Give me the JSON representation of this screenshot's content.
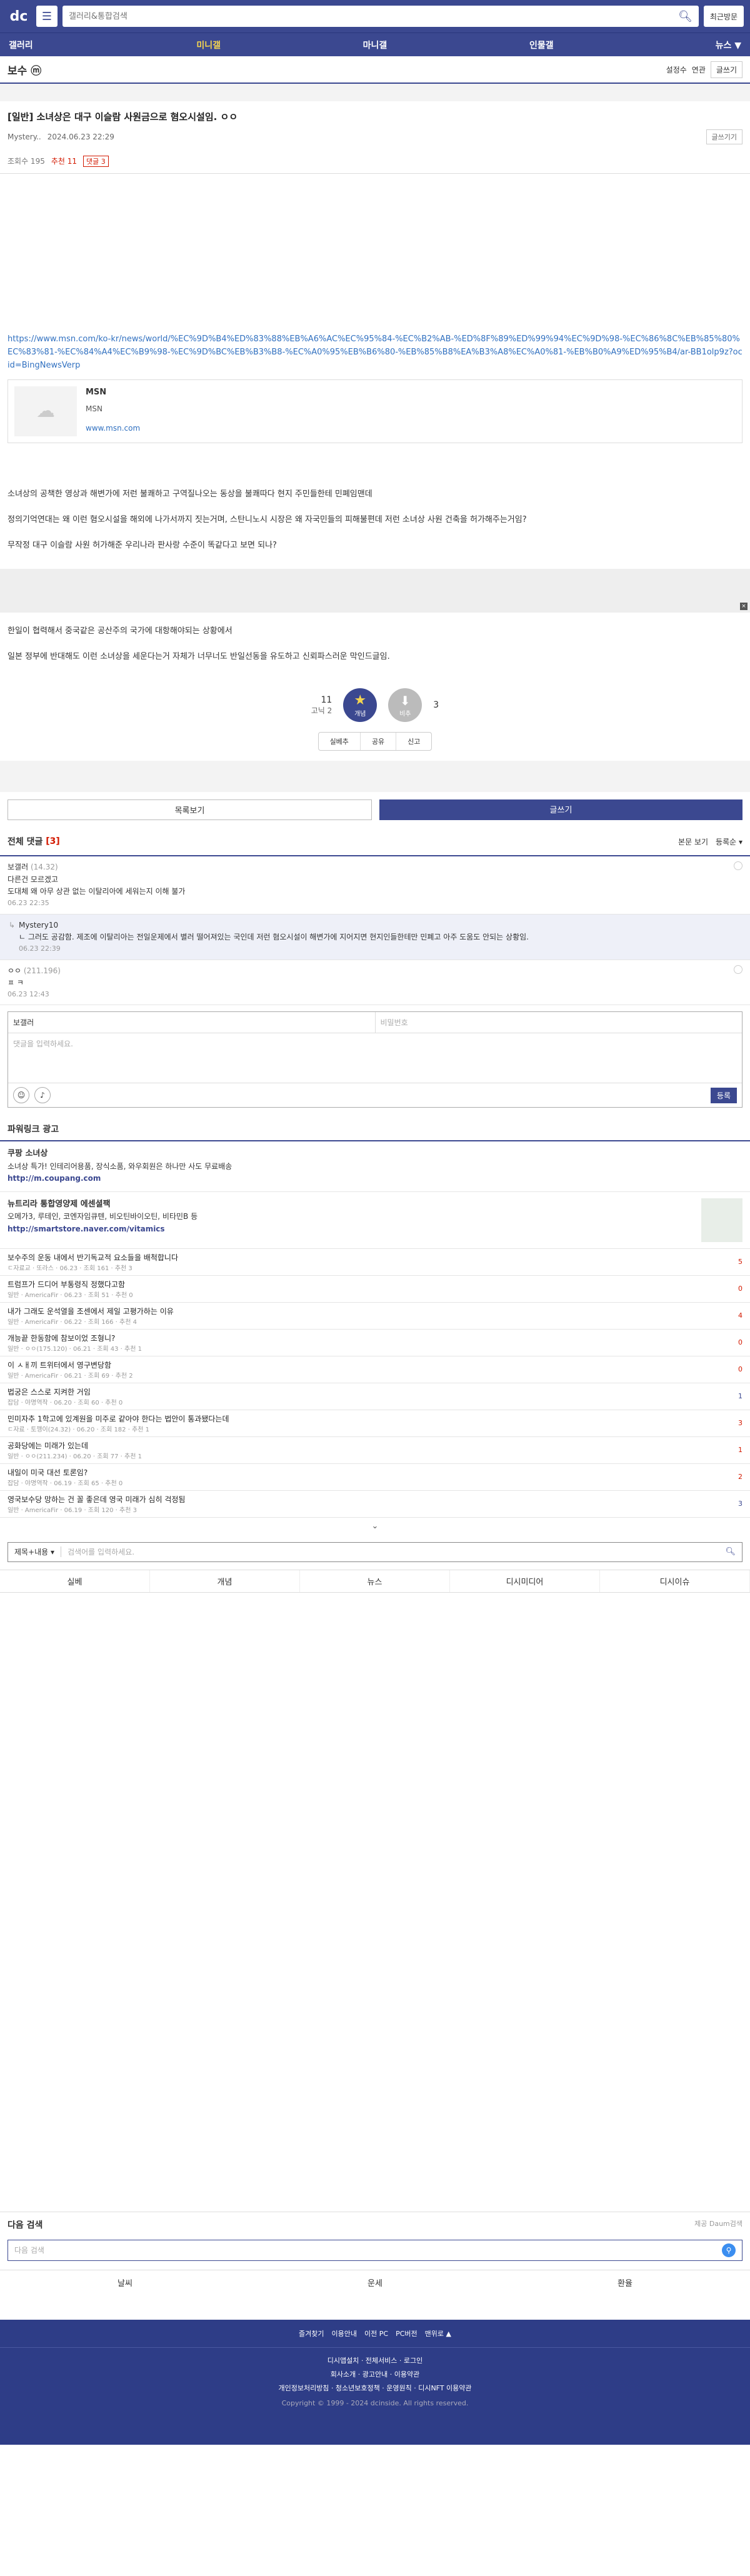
{
  "header": {
    "logo": "dc",
    "search_placeholder": "갤러리&통합검색",
    "recent": "최근방문"
  },
  "gnb": [
    "갤러리",
    "미니갤",
    "마니갤",
    "인물갤",
    "뉴스 ▼"
  ],
  "gallery": {
    "name": "보수 ⓜ",
    "setting": "설정수",
    "tab": "연관",
    "write": "글쓰기"
  },
  "post": {
    "title": "[일반] 소녀상은 대구 이슬람 사원금으로 혐오시설임. ㅇㅇ",
    "author": "Mystery..",
    "date": "2024.06.23 22:29",
    "list_btn": "글쓰기기",
    "views": "조회수 195",
    "recommend": "추천 11",
    "comments": "댓글 3",
    "url": "https://www.msn.com/ko-kr/news/world/%EC%9D%B4%ED%83%88%EB%A6%AC%EC%95%84-%EC%B2%AB-%ED%8F%89%ED%99%94%EC%9D%98-%EC%86%8C%EB%85%80%EC%83%81-%EC%84%A4%EC%B9%98-%EC%9D%BC%EB%B3%B8-%EC%A0%95%EB%B6%80-%EB%85%B8%EA%B3%A8%EC%A0%81-%EB%B0%A9%ED%95%B4/ar-BB1olp9z?ocid=BingNewsVerp",
    "og_title": "MSN",
    "og_desc": "MSN",
    "og_url": "www.msn.com",
    "p1": "소녀상의 공책한 영상과 해변가에 저런 불쾌하고 구역질나오는 동상을 불쾌따다 현지 주민들한테 민폐임맨데",
    "p2": "정의기억연대는 왜 이런 혐오시설을 해외에 나가서까지 짓는거며, 스탄니노시 시장은 왜 자국민들의 피해불편데 저런 소녀상 사원 건축을 허가해주는거임?",
    "p3": "무작정 대구 이슬람 사원 허가해준 우리나라 판사랑 수준이 똑같다고 보면 되나?",
    "p4": "한일이 협력해서 중국같은 공산주의 국가에 대항해야되는 상황에서",
    "p5": "일본 정부에 반대해도 이런 소녀상을 세운다는거 자체가 너무너도 반일선동을 유도하고 신뢰파스러운 막인드글임.",
    "up_count": "11",
    "up_sub": "고닉 2",
    "up_label": "개념",
    "down_count": "3",
    "down_label": "비추",
    "share": [
      "실베추",
      "공유",
      "신고"
    ]
  },
  "actions": {
    "list": "목록보기",
    "write": "글쓰기"
  },
  "comments": {
    "title": "전체 댓글",
    "count": "[3]",
    "sort1": "본문 보기",
    "sort2": "등록순 ▾",
    "items": [
      {
        "nick": "보갤러",
        "ip": "(14.32)",
        "text": "다른건 모르겠고\n도대체 왜 아무 상관 없는 이탈리아에 세워는지 이해 불가",
        "date": "06.23 22:35"
      },
      {
        "nick": "Mystery10",
        "ip": "",
        "text": "ㄴ 그러도 공감함. 제조에 이탈리아는 전일운제에서 별러 떨어져있는 국인데 저런 혐오시설이 해변가에 지어지면 현지인들한테만 민폐고 아주 도움도 안되는 상황임.",
        "date": "06.23 22:39"
      },
      {
        "nick": "ㅇㅇ",
        "ip": "(211.196)",
        "text": "ㅍ ㅋ",
        "date": "06.23 12:43"
      }
    ]
  },
  "write": {
    "nick": "보갤러",
    "pw": "비밀번호",
    "placeholder": "댓글을 입력하세요.",
    "submit": "등록"
  },
  "ads": {
    "title": "파워링크 광고",
    "items": [
      {
        "t": "쿠팡 소녀상",
        "d": "소녀상 특가! 인테리어용품, 장식소품, 와우회원은 하나만 사도 무료배송",
        "u": "http://m.coupang.com"
      },
      {
        "t": "뉴트리라 통합영양제 에센셜팩",
        "d": "오메가3, 루테인, 코엔자임큐텐, 비오틴바이오틴, 비타민B 등",
        "u": "http://smartstore.naver.com/vitamics"
      }
    ]
  },
  "list": [
    {
      "t": "보수주의 운동 내에서 반기독교적 요소들을 배척합니다",
      "m": "ㄷ자료교 · 또라스 · 06.23 · 조회 161 · 추천 3",
      "n": "5"
    },
    {
      "t": "트럼프가 드디어 부통령직 정했다고함",
      "m": "일반 · AmericaFir · 06.23 · 조회 51 · 추천 0",
      "n": "0"
    },
    {
      "t": "내가 그래도 운석열을 조센에서 제일 고평가하는 이유",
      "m": "일반 · AmericaFir · 06.22 · 조회 166 · 추천 4",
      "n": "4"
    },
    {
      "t": "개능끝 한동함에 참보이었 조형니?",
      "m": "일반 · ㅇㅇ(175.120) · 06.21 · 조회 43 · 추천 1",
      "n": "0"
    },
    {
      "t": "이 ㅅㅐ끼 트위터에서 영구변당함",
      "m": "일반 · AmericaFir · 06.21 · 조회 69 · 추천 2",
      "n": "0"
    },
    {
      "t": "법궁은 스스로 지켜한 거임",
      "m": "잡담 · 야명역작 · 06.20 · 조회 60 · 추천 0",
      "n": "1"
    },
    {
      "t": "민미자추 1학고에 있계원을 미주로 같아야 한다는 법안이 통과됐다는데",
      "m": "ㄷ자료 · 토깽이(24.32) · 06.20 · 조회 182 · 추천 1",
      "n": "3"
    },
    {
      "t": "공화당에는 미래가 있는데",
      "m": "일반 · ㅇㅇ(211.234) · 06.20 · 조회 77 · 추천 1",
      "n": "1"
    },
    {
      "t": "내일이 미국 대선 토론임?",
      "m": "잡담 · 야명역작 · 06.19 · 조회 65 · 추천 0",
      "n": "2"
    },
    {
      "t": "영국보수당 망하는 건 꼴 좋은데 영국 미래가 심히 걱정됨",
      "m": "일반 · AmericaFir · 06.19 · 조회 120 · 추천 3",
      "n": "3"
    }
  ],
  "bsearch": {
    "select": "제목+내용 ▾",
    "placeholder": "검색어를 입력하세요."
  },
  "cat_tabs": [
    "실베",
    "개념",
    "뉴스",
    "디시미디어",
    "디시이슈"
  ],
  "next": {
    "title": "다음 검색",
    "powered": "제공 Daum검색",
    "placeholder": "다음 검색",
    "tabs": [
      "날씨",
      "운세",
      "환율"
    ]
  },
  "footer": {
    "top": [
      "즐겨찾기",
      "이용안내",
      "이전 PC",
      "PC버전",
      "맨위로 ▲"
    ],
    "l1": "디시앱설치 · 전체서비스 · 로그인",
    "l2": "회사소개 · 광고안내 · 이용약관",
    "l3": "개인정보처리방침 · 청소년보호정책 · 운영원칙 · 디시NFT 이용약관",
    "copy": "Copyright © 1999 - 2024 dcinside. All rights reserved."
  }
}
